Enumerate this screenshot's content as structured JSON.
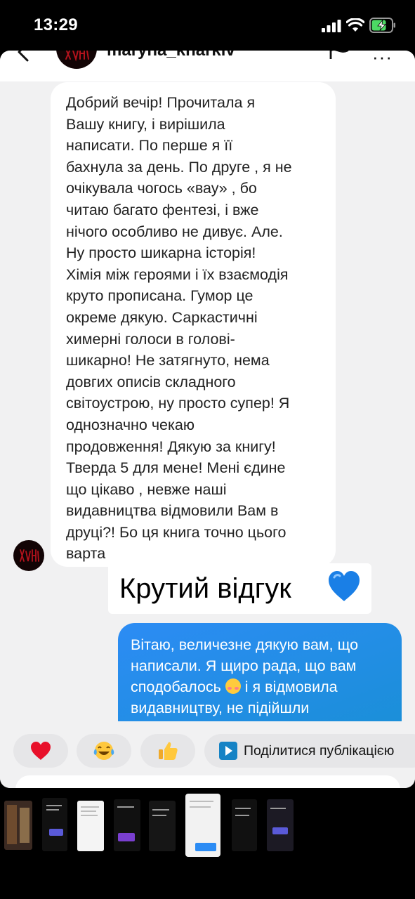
{
  "status_bar": {
    "time": "13:29"
  },
  "header": {
    "username": "maryna_kharkiv",
    "more_label": "···"
  },
  "incoming_message": {
    "text": "Добрий вечір! Прочитала я\nВашу книгу, і вирішила\nнаписати. По перше я її\nбахнула за день. По друге , я не\nочікувала чогось «вау» , бо\nчитаю багато фентезі, і вже\nнічого особливо не дивує. Але.\nНу просто шикарна історія!\nХімія між героями і їх взаємодія\nкруто прописана. Гумор це\nокреме дякую. Саркастичні\nхимерні голоси в голові-\nшикарно! Не затягнуто, нема\nдовгих описів складного\nсвітоустрою, ну просто супер! Я\nоднозначно чекаю\nпродовження! Дякую за книгу!\nТверда 5 для мене! Мені єдине\nщо цікаво , невже наші\nвидавництва відмовили Вам в\nдруці?! Бо ця книга точно цього\nварта"
  },
  "caption": {
    "text": "Крутий відгук",
    "emoji_icon": "blue-heart-icon",
    "emoji_color": "#1a7fe6"
  },
  "outgoing_message": {
    "line1": "Вітаю, величезне дякую вам, що",
    "line2": "написали. Я щиро рада, що вам",
    "line3_before": "сподобалось ",
    "line3_after": " і я відмовила",
    "line4": "видавництву,  не підійшли",
    "emoji_icon": "smiling-face-with-hearts-icon"
  },
  "reactions": {
    "heart": "❤️",
    "laugh": "😂",
    "thumbs_up": "👍",
    "share_label": "Поділитися публікацією"
  },
  "colors": {
    "outgoing_bubble": "#1b8fd9",
    "background": "#f1f1f2",
    "share_icon": "#1583c5"
  }
}
